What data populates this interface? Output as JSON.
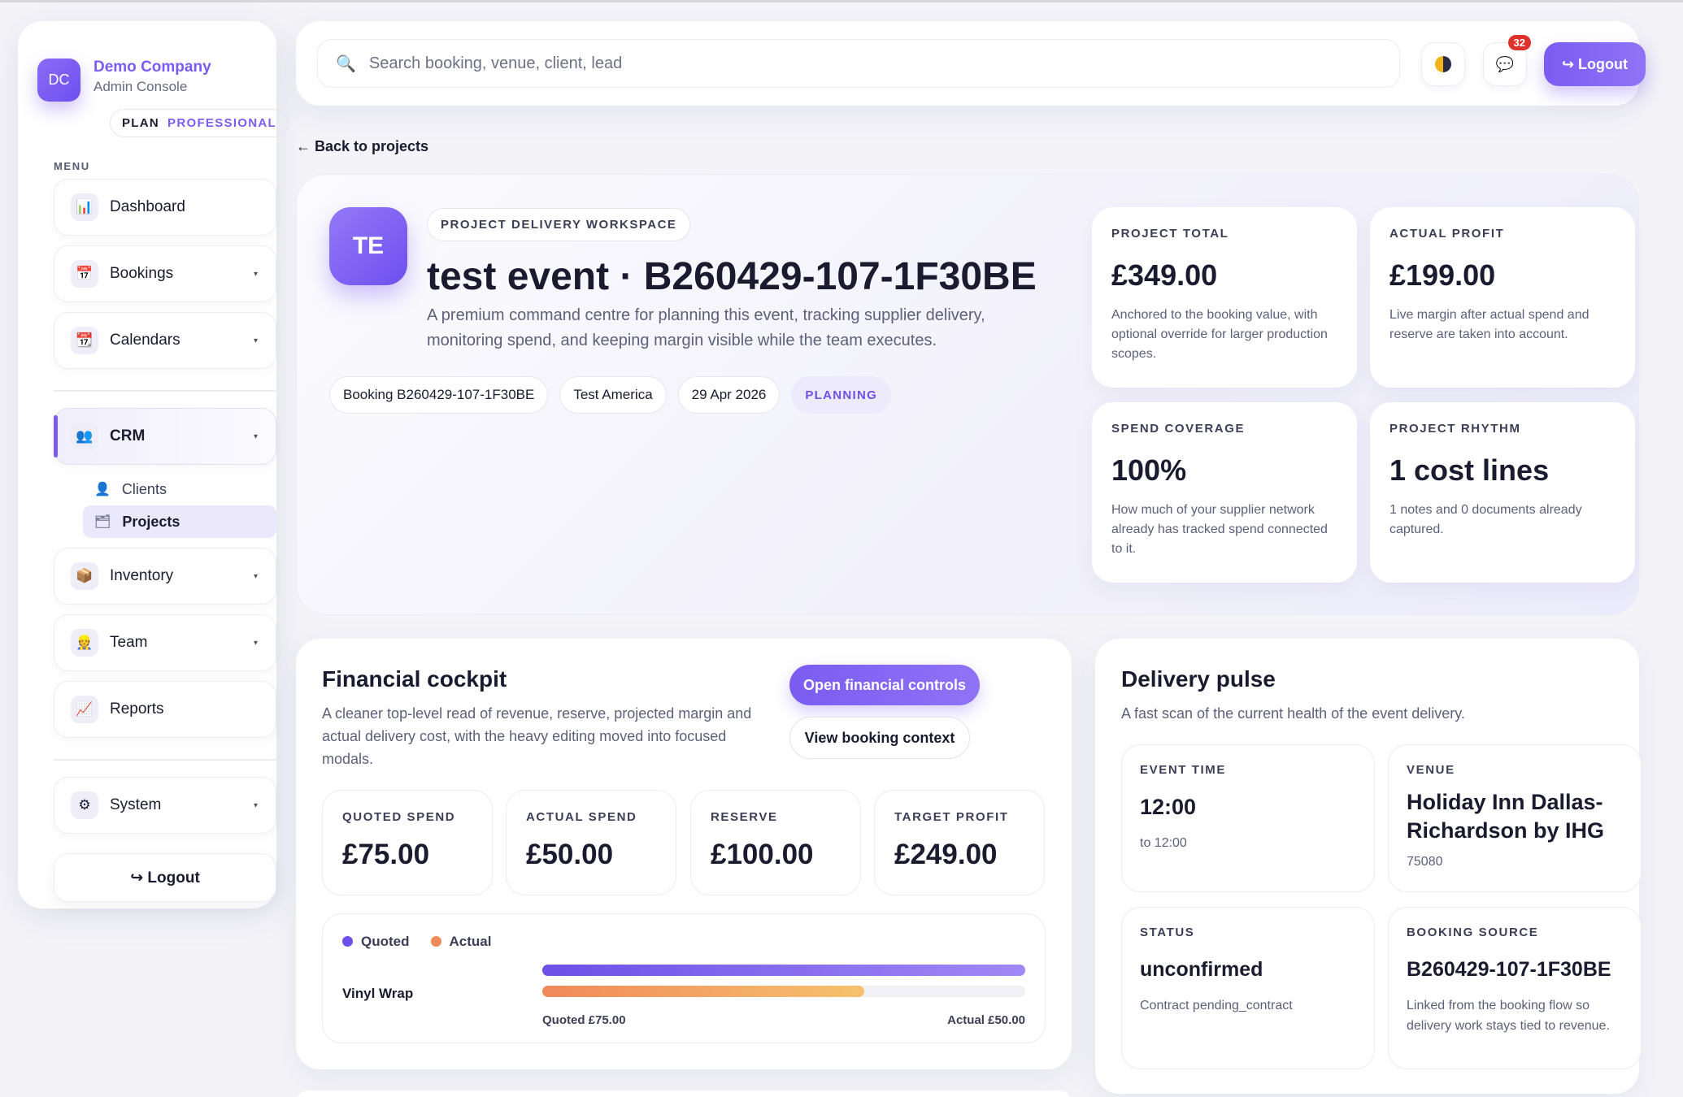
{
  "brand": {
    "initials": "DC",
    "name": "Demo Company",
    "subtitle": "Admin Console",
    "plan_label": "PLAN",
    "plan_value": "PROFESSIONAL"
  },
  "sidebar": {
    "menu_label": "MENU",
    "items": [
      {
        "label": "Dashboard",
        "icon": "chart-icon"
      },
      {
        "label": "Bookings",
        "icon": "calendar-icon"
      },
      {
        "label": "Calendars",
        "icon": "calendar-tear-icon"
      },
      {
        "label": "CRM",
        "icon": "people-icon"
      },
      {
        "label": "Inventory",
        "icon": "package-icon"
      },
      {
        "label": "Team",
        "icon": "worker-icon"
      },
      {
        "label": "Reports",
        "icon": "trend-icon"
      },
      {
        "label": "System",
        "icon": "gear-icon"
      }
    ],
    "crm_sub": [
      {
        "label": "Clients"
      },
      {
        "label": "Projects"
      }
    ],
    "logout": "↪ Logout"
  },
  "topbar": {
    "search_placeholder": "Search booking, venue, client, lead",
    "notifications": "32",
    "logout": "↪ Logout"
  },
  "back_link": "← Back to projects",
  "hero": {
    "initials": "TE",
    "tag": "PROJECT DELIVERY WORKSPACE",
    "title": "test event · B260429-107-1F30BE",
    "description": "A premium command centre for planning this event, tracking supplier delivery, monitoring spend, and keeping margin visible while the team executes.",
    "chips": [
      "Booking B260429-107-1F30BE",
      "Test America",
      "29 Apr 2026"
    ],
    "status": "PLANNING",
    "stats": [
      {
        "label": "PROJECT TOTAL",
        "value": "£349.00",
        "desc": "Anchored to the booking value, with optional override for larger production scopes."
      },
      {
        "label": "ACTUAL PROFIT",
        "value": "£199.00",
        "desc": "Live margin after actual spend and reserve are taken into account."
      },
      {
        "label": "SPEND COVERAGE",
        "value": "100%",
        "desc": "How much of your supplier network already has tracked spend connected to it."
      },
      {
        "label": "PROJECT RHYTHM",
        "value": "1 cost lines",
        "desc": "1 notes and 0 documents already captured."
      }
    ]
  },
  "financial": {
    "title": "Financial cockpit",
    "description": "A cleaner top-level read of revenue, reserve, projected margin and actual delivery cost, with the heavy editing moved into focused modals.",
    "btn_primary": "Open financial controls",
    "btn_secondary": "View booking context",
    "metrics": [
      {
        "label": "QUOTED SPEND",
        "value": "£75.00"
      },
      {
        "label": "ACTUAL SPEND",
        "value": "£50.00"
      },
      {
        "label": "RESERVE",
        "value": "£100.00"
      },
      {
        "label": "TARGET PROFIT",
        "value": "£249.00"
      }
    ],
    "legend": {
      "quoted": "Quoted",
      "actual": "Actual"
    },
    "line_item": {
      "name": "Vinyl Wrap",
      "quoted_fraction": 1.0,
      "actual_fraction": 0.667,
      "quoted_caption": "Quoted £75.00",
      "actual_caption": "Actual £50.00"
    },
    "colors": {
      "quoted": "#6c50e8",
      "actual": "#f0895a"
    }
  },
  "delivery": {
    "title": "Delivery pulse",
    "description": "A fast scan of the current health of the event delivery.",
    "cards": [
      {
        "label": "EVENT TIME",
        "value": "12:00",
        "desc": "to 12:00"
      },
      {
        "label": "VENUE",
        "value": "Holiday Inn Dallas-Richardson by IHG",
        "desc": "75080"
      },
      {
        "label": "STATUS",
        "value": "unconfirmed",
        "desc": "Contract pending_contract"
      },
      {
        "label": "BOOKING SOURCE",
        "value": "B260429-107-1F30BE",
        "desc": "Linked from the booking flow so delivery work stays tied to revenue."
      }
    ]
  }
}
